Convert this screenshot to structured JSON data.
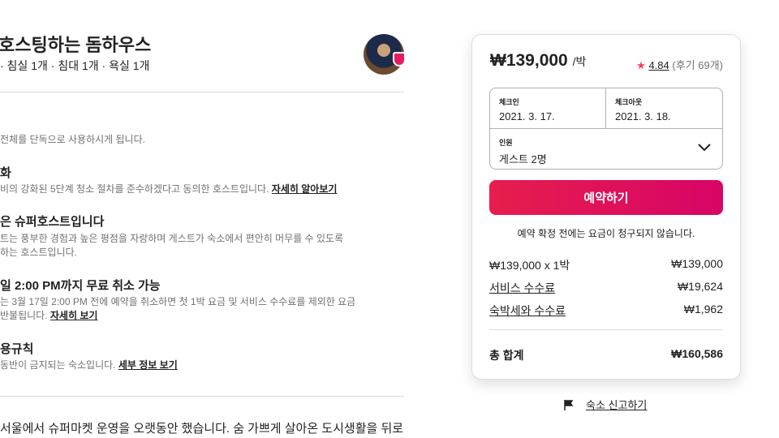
{
  "listing": {
    "title": "호스팅하는 돔하우스",
    "subtitle": "· 침실 1개 · 침대 1개 · 욕실 1개"
  },
  "highlights": [
    {
      "title": "",
      "text": "전체를 단독으로 사용하시게 됩니다."
    },
    {
      "title": "화",
      "text": "비의 강화된 5단계 청소 절차를 준수하겠다고 동의한 호스트입니다.",
      "link": "자세히 알아보기"
    },
    {
      "title": "은 슈퍼호스트입니다",
      "text": "트는 풍부한 경험과 높은 평점을 자랑하며 게스트가 숙소에서 편안히 머무를 수 있도록",
      "text2": "하는 호스트입니다."
    },
    {
      "title": "일 2:00 PM까지 무료 취소 가능",
      "text": "는 3월 17일 2:00 PM 전에 예약을 취소하면 첫 1박 요금 및 서비스 수수료를 제외한 요금",
      "text2": "반불됩니다.",
      "link": "자세히 보기"
    },
    {
      "title": "용규칙",
      "text": "동반이 금지되는 숙소입니다.",
      "link": "세부 정보 보기"
    }
  ],
  "description": "서울에서 슈퍼마켓 운영을 오랫동안 했습니다. 숨 가쁘게 살아온 도시생활을 뒤로",
  "booking": {
    "price": "₩139,000",
    "per_night": "/박",
    "rating": "4.84",
    "reviews": "(후기 69개)",
    "checkin_label": "체크인",
    "checkin": "2021. 3. 17.",
    "checkout_label": "체크아웃",
    "checkout": "2021. 3. 18.",
    "guests_label": "인원",
    "guests": "게스트 2명",
    "reserve": "예약하기",
    "note": "예약 확정 전에는 요금이 청구되지 않습니다.",
    "lines": [
      {
        "label": "₩139,000 x 1박",
        "value": "₩139,000"
      },
      {
        "label": "서비스 수수료",
        "value": "₩19,624"
      },
      {
        "label": "숙박세와 수수료",
        "value": "₩1,962"
      }
    ],
    "total_label": "총 합계",
    "total": "₩160,586",
    "accent": "#e31c5f"
  },
  "report": "숙소 신고하기"
}
